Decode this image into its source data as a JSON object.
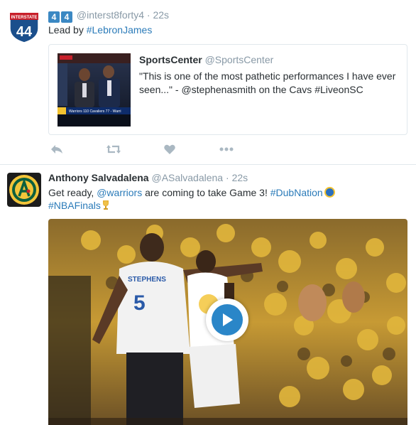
{
  "tweet1": {
    "badges": [
      "4",
      "4"
    ],
    "handle": "@interst8forty4",
    "sep": "·",
    "time": "22s",
    "text_prefix": "Lead by ",
    "hashtag": "#LebronJames",
    "avatar": {
      "top_label": "INTERSTATE",
      "number": "44"
    },
    "quote": {
      "name": "SportsCenter",
      "handle": "@SportsCenter",
      "text": "\"This is one of the most pathetic performances I have ever seen...\" - @stephenasmith on the Cavs #LiveonSC",
      "image_ticker": "Warriors 110 Cavaliers 77 - Warri"
    }
  },
  "actions": {
    "reply": "reply-icon",
    "retweet": "retweet-icon",
    "like": "heart-icon",
    "more": "more-icon"
  },
  "tweet2": {
    "name": "Anthony Salvadalena",
    "handle": "@ASalvadalena",
    "sep": "·",
    "time": "22s",
    "text_a": "Get ready, ",
    "mention": "@warriors",
    "text_b": " are coming to take Game 3! ",
    "hashtag1": "#DubNation",
    "hashtag2": "#NBAFinals",
    "avatar_icon": "athletics-logo-icon",
    "video": {
      "jersey_name": "STEPHENS",
      "jersey_number": "5",
      "play": "play-icon"
    }
  },
  "colors": {
    "link": "#2b7bb9",
    "muted": "#8899a6",
    "badge": "#3b88c3",
    "play": "#2a86c8"
  }
}
